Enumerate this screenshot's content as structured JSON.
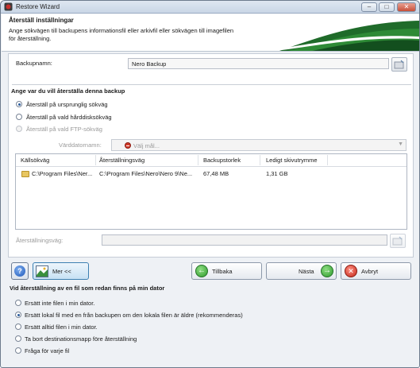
{
  "window": {
    "title": "Restore Wizard",
    "buttons": {
      "minimize": "–",
      "maximize": "□",
      "close": "✕"
    }
  },
  "header": {
    "title": "Återställ inställningar",
    "description": "Ange sökvägen till backupens informationsfil eller arkivfil eller sökvägen till imagefilen för återställning."
  },
  "backup": {
    "label": "Backupnamn:",
    "value": "Nero Backup"
  },
  "restore_location": {
    "heading": "Ange var du vill återställa denna backup",
    "options": [
      {
        "label": "Återställ på ursprunglig sökväg",
        "selected": true,
        "enabled": true
      },
      {
        "label": "Återställ på vald hårddisksökväg",
        "selected": false,
        "enabled": true
      },
      {
        "label": "Återställ på vald FTP-sökväg",
        "selected": false,
        "enabled": false
      }
    ],
    "host_label": "Värddatornamn:",
    "host_value": "Välj mål..."
  },
  "table": {
    "columns": [
      "Källsökväg",
      "Återställningsväg",
      "Backupstorlek",
      "Ledigt skivutrymme"
    ],
    "rows": [
      [
        "C:\\Program Files\\Ner...",
        "C:\\Program Files\\Nero\\Nero 9\\Ne...",
        "67,48 MB",
        "1,31 GB"
      ]
    ]
  },
  "restore_path": {
    "label": "Återställningsväg:",
    "value": ""
  },
  "buttons": {
    "help": "?",
    "more": "Mer <<",
    "back": "Tillbaka",
    "next": "Nästa",
    "cancel": "Avbryt"
  },
  "conflict": {
    "heading": "Vid återställning av en fil som redan finns på min dator",
    "options": [
      {
        "label": "Ersätt inte filen i min dator.",
        "selected": false
      },
      {
        "label": "Ersätt lokal fil med en från backupen om den lokala filen är äldre (rekommenderas)",
        "selected": true
      },
      {
        "label": "Ersätt alltid filen i min dator.",
        "selected": false
      },
      {
        "label": "Ta bort destinationsmapp före återställning",
        "selected": false
      },
      {
        "label": "Fråga för varje fil",
        "selected": false
      }
    ]
  },
  "colors": {
    "accent": "#2d9a2b",
    "swoosh": "#1f6b2a",
    "title_bar": "#c9d6e6"
  }
}
